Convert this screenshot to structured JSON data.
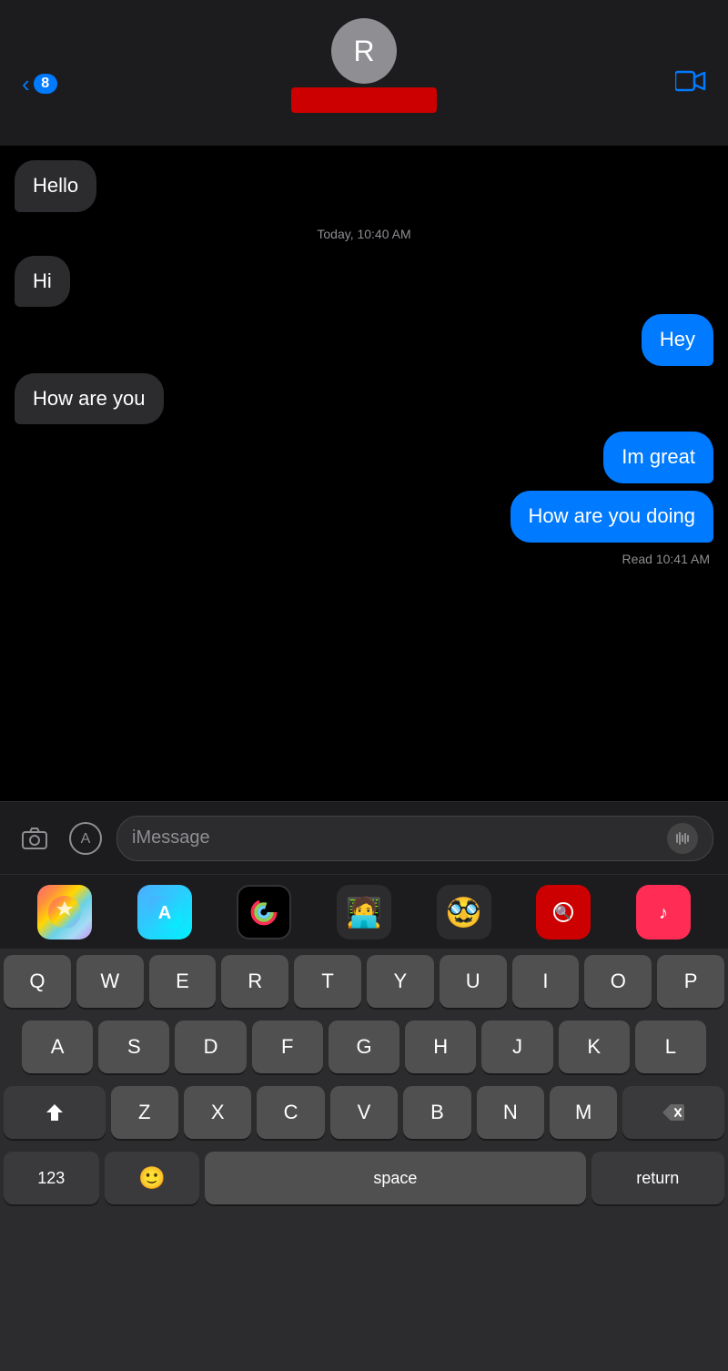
{
  "header": {
    "back_count": "8",
    "contact_initial": "R",
    "video_icon": "📹"
  },
  "messages": [
    {
      "id": 1,
      "type": "received",
      "text": "Hello"
    },
    {
      "id": 2,
      "type": "timestamp",
      "text": "Today, 10:40 AM"
    },
    {
      "id": 3,
      "type": "received",
      "text": "Hi"
    },
    {
      "id": 4,
      "type": "sent",
      "text": "Hey"
    },
    {
      "id": 5,
      "type": "received",
      "text": "How are you"
    },
    {
      "id": 6,
      "type": "sent",
      "text": "Im great"
    },
    {
      "id": 7,
      "type": "sent",
      "text": "How are you doing"
    },
    {
      "id": 8,
      "type": "read_receipt",
      "text": "Read 10:41 AM"
    }
  ],
  "input": {
    "placeholder": "iMessage"
  },
  "keyboard": {
    "row1": [
      "Q",
      "W",
      "E",
      "R",
      "T",
      "Y",
      "U",
      "I",
      "O",
      "P"
    ],
    "row2": [
      "A",
      "S",
      "D",
      "F",
      "G",
      "H",
      "J",
      "K",
      "L"
    ],
    "row3": [
      "Z",
      "X",
      "C",
      "V",
      "B",
      "N",
      "M"
    ],
    "space_label": "space",
    "return_label": "return",
    "num_label": "123"
  }
}
